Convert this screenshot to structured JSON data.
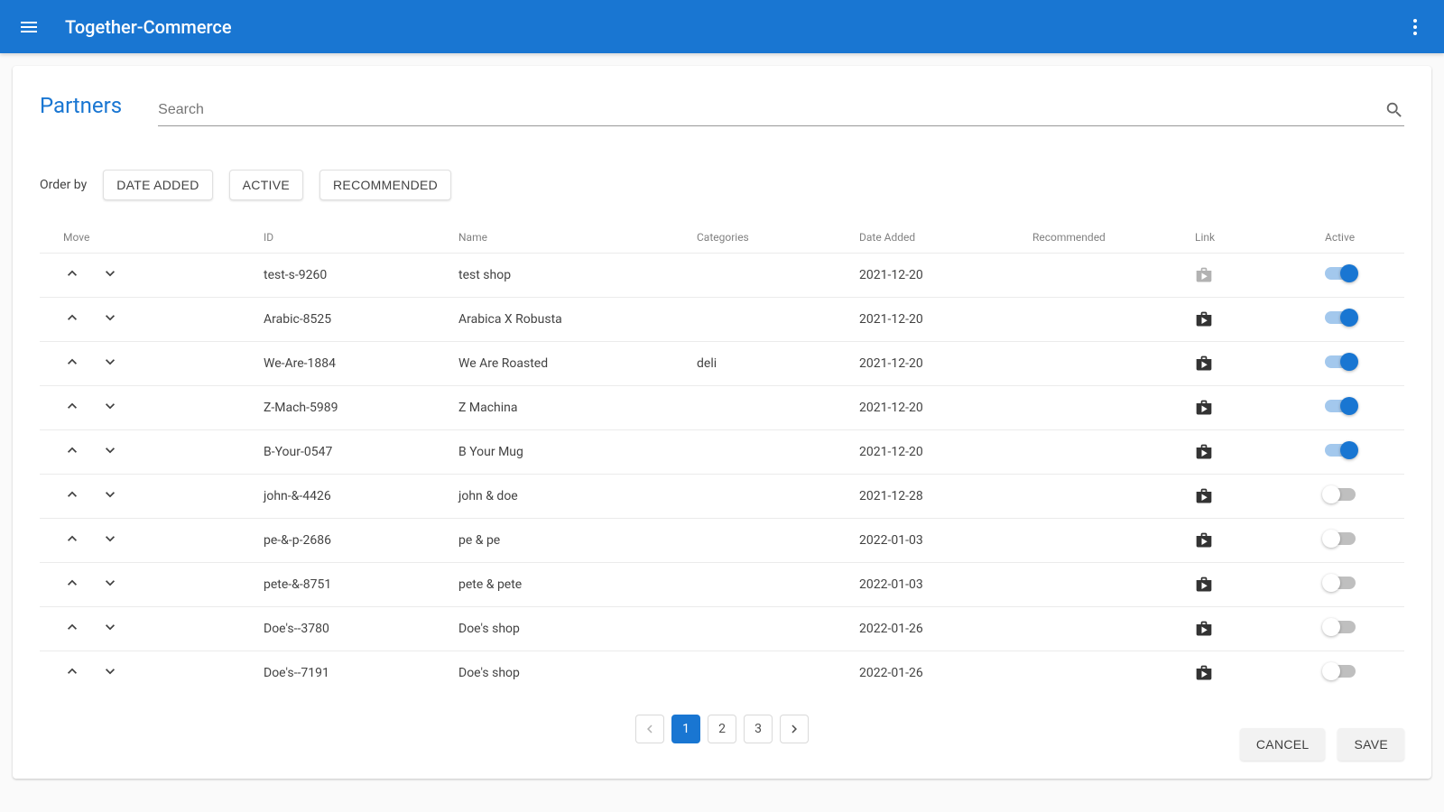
{
  "appbar": {
    "title": "Together-Commerce"
  },
  "page": {
    "title": "Partners"
  },
  "search": {
    "placeholder": "Search"
  },
  "orderby": {
    "label": "Order by",
    "options": [
      "DATE ADDED",
      "ACTIVE",
      "RECOMMENDED"
    ]
  },
  "columns": {
    "move": "Move",
    "id": "ID",
    "name": "Name",
    "categories": "Categories",
    "date_added": "Date Added",
    "recommended": "Recommended",
    "link": "Link",
    "active": "Active"
  },
  "rows": [
    {
      "id": "test-s-9260",
      "name": "test shop",
      "categories": "",
      "date": "2021-12-20",
      "recommended": "",
      "link_enabled": false,
      "active": true
    },
    {
      "id": "Arabic-8525",
      "name": "Arabica X Robusta",
      "categories": "",
      "date": "2021-12-20",
      "recommended": "",
      "link_enabled": true,
      "active": true
    },
    {
      "id": "We-Are-1884",
      "name": "We Are Roasted",
      "categories": "deli",
      "date": "2021-12-20",
      "recommended": "",
      "link_enabled": true,
      "active": true
    },
    {
      "id": "Z-Mach-5989",
      "name": "Z Machina",
      "categories": "",
      "date": "2021-12-20",
      "recommended": "",
      "link_enabled": true,
      "active": true
    },
    {
      "id": "B-Your-0547",
      "name": "B Your Mug",
      "categories": "",
      "date": "2021-12-20",
      "recommended": "",
      "link_enabled": true,
      "active": true
    },
    {
      "id": "john-&-4426",
      "name": "john & doe",
      "categories": "",
      "date": "2021-12-28",
      "recommended": "",
      "link_enabled": true,
      "active": false
    },
    {
      "id": "pe-&-p-2686",
      "name": "pe & pe",
      "categories": "",
      "date": "2022-01-03",
      "recommended": "",
      "link_enabled": true,
      "active": false
    },
    {
      "id": "pete-&-8751",
      "name": "pete & pete",
      "categories": "",
      "date": "2022-01-03",
      "recommended": "",
      "link_enabled": true,
      "active": false
    },
    {
      "id": "Doe's--3780",
      "name": "Doe's shop",
      "categories": "",
      "date": "2022-01-26",
      "recommended": "",
      "link_enabled": true,
      "active": false
    },
    {
      "id": "Doe's--7191",
      "name": "Doe's shop",
      "categories": "",
      "date": "2022-01-26",
      "recommended": "",
      "link_enabled": true,
      "active": false
    }
  ],
  "pagination": {
    "pages": [
      "1",
      "2",
      "3"
    ],
    "current": 1
  },
  "actions": {
    "cancel": "CANCEL",
    "save": "SAVE"
  }
}
